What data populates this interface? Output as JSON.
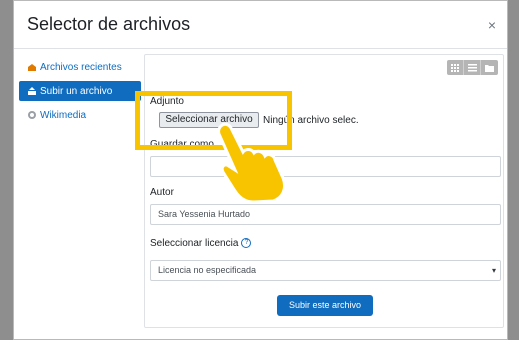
{
  "dialog": {
    "title": "Selector de archivos",
    "close_glyph": "×"
  },
  "sidebar": {
    "items": [
      {
        "label": "Archivos recientes",
        "icon": "recent-files-icon",
        "active": false
      },
      {
        "label": "Subir un archivo",
        "icon": "upload-icon",
        "active": true
      },
      {
        "label": "Wikimedia",
        "icon": "wikimedia-icon",
        "active": false
      }
    ]
  },
  "view_toggle": [
    "grid-view-icon",
    "list-view-icon",
    "folder-view-icon"
  ],
  "form": {
    "attachment_label": "Adjunto",
    "choose_file_button": "Seleccionar archivo",
    "file_status": "Ningún archivo selec.",
    "save_as_label": "Guardar como",
    "save_as_value": "",
    "author_label": "Autor",
    "author_value": "Sara Yessenia Hurtado",
    "license_label": "Seleccionar licencia",
    "license_selected": "Licencia no especificada",
    "submit_button": "Subir este archivo"
  },
  "colors": {
    "accent": "#0f6cbf",
    "highlight": "#f8c400"
  }
}
